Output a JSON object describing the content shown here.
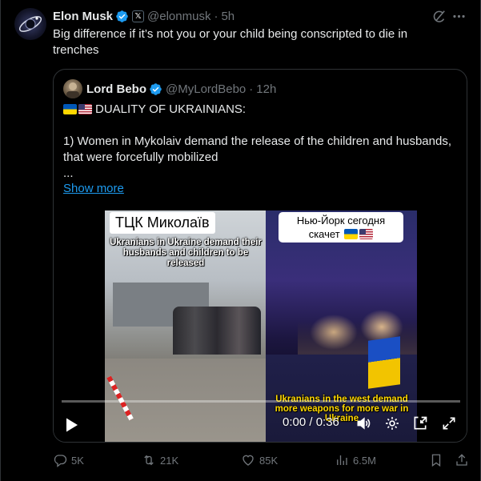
{
  "tweet": {
    "author_name": "Elon Musk",
    "affiliation_badge": "𝕏",
    "handle": "@elonmusk",
    "separator": "·",
    "time": "5h",
    "text": "Big difference if it’s not you or your child being conscripted to die in trenches"
  },
  "quote": {
    "author_name": "Lord Bebo",
    "handle": "@MyLordBebo",
    "separator": "·",
    "time": "12h",
    "headline": "DUALITY OF UKRAINIANS:",
    "body_line": "1) Women in Mykolaiv demand the release of the children and husbands, that were forcefully mobilized",
    "ellipsis": "...",
    "show_more": "Show more"
  },
  "video": {
    "left_title": "ТЦК Миколаїв",
    "left_caption": "Ukranians in Ukraine demand their husbands and children to be released",
    "right_title": "Нью-Йорк сегодня скачет",
    "right_caption": "Ukranians in the west demand more weapons for more war in Ukraine",
    "timecode": "0:00 / 0:36",
    "progress": 0
  },
  "actions": {
    "replies": "5K",
    "retweets": "21K",
    "likes": "85K",
    "views": "6.5M"
  },
  "colors": {
    "background": "#000000",
    "text": "#e7e9ea",
    "muted": "#71767b",
    "accent": "#1d9bf0",
    "border": "#2f3336"
  },
  "icons": {
    "verified": "verified-badge-icon",
    "grok": "grok-icon",
    "more": "more-icon",
    "play": "play-icon",
    "volume": "volume-icon",
    "settings": "settings-icon",
    "pip": "picture-in-picture-icon",
    "fullscreen": "fullscreen-icon",
    "reply": "reply-icon",
    "retweet": "retweet-icon",
    "like": "heart-icon",
    "views": "views-icon",
    "bookmark": "bookmark-icon",
    "share": "share-icon"
  }
}
